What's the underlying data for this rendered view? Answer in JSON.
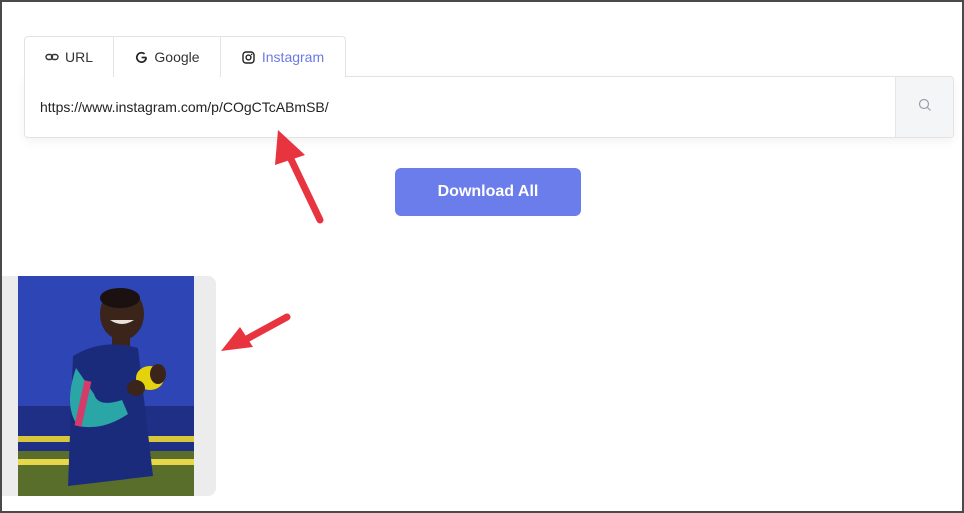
{
  "tabs": [
    {
      "label": "URL",
      "icon": "link-icon"
    },
    {
      "label": "Google",
      "icon": "google-icon"
    },
    {
      "label": "Instagram",
      "icon": "instagram-icon",
      "active": true
    }
  ],
  "search": {
    "value": "https://www.instagram.com/p/COgCTcABmSB/",
    "button_icon": "search-icon"
  },
  "actions": {
    "download_all_label": "Download All"
  },
  "results": [
    {
      "type": "image",
      "description_icon": "photo-thumbnail"
    }
  ],
  "colors": {
    "accent": "#6b7deb",
    "active_tab_text": "#6b7ae6",
    "annotation_arrow": "#e8343f"
  }
}
